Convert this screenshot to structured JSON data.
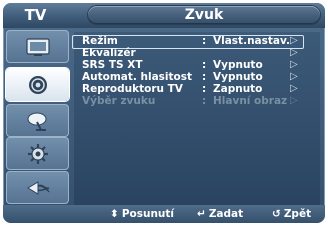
{
  "header": {
    "tv_label": "TV",
    "menu_title": "Zvuk"
  },
  "sidebar": {
    "items": [
      {
        "icon": "picture-icon",
        "active": false
      },
      {
        "icon": "sound-icon",
        "active": true
      },
      {
        "icon": "channel-icon",
        "active": false
      },
      {
        "icon": "setup-icon",
        "active": false
      },
      {
        "icon": "input-icon",
        "active": false
      }
    ]
  },
  "menu": {
    "items": [
      {
        "label": "Režim",
        "colon": ":",
        "value": "Vlast.nastav.",
        "arrow": "▷",
        "selected": true,
        "enabled": true
      },
      {
        "label": "Ekvalizér",
        "colon": "",
        "value": "",
        "arrow": "▷",
        "selected": false,
        "enabled": true
      },
      {
        "label": "SRS TS XT",
        "colon": ":",
        "value": "Vypnuto",
        "arrow": "▷",
        "selected": false,
        "enabled": true
      },
      {
        "label": "Automat. hlasitost",
        "colon": ":",
        "value": "Vypnuto",
        "arrow": "▷",
        "selected": false,
        "enabled": true
      },
      {
        "label": "Reproduktoru TV",
        "colon": ":",
        "value": "Zapnuto",
        "arrow": "▷",
        "selected": false,
        "enabled": true
      },
      {
        "label": "Výběr zvuku",
        "colon": ":",
        "value": "Hlavní obraz",
        "arrow": "▷",
        "selected": false,
        "enabled": false
      }
    ]
  },
  "footer": {
    "move": {
      "icon": "updown-icon",
      "glyph": "⬍",
      "label": "Posunutí"
    },
    "enter": {
      "icon": "enter-icon",
      "glyph": "↵",
      "label": "Zadat"
    },
    "back": {
      "icon": "return-icon",
      "glyph": "↺",
      "label": "Zpět"
    }
  },
  "colors": {
    "panel": "#3c5a79",
    "frame": "#4d6d8d",
    "active_tile": "#ffffff",
    "text": "#ffffff",
    "disabled_text": "#7a8fa3"
  }
}
